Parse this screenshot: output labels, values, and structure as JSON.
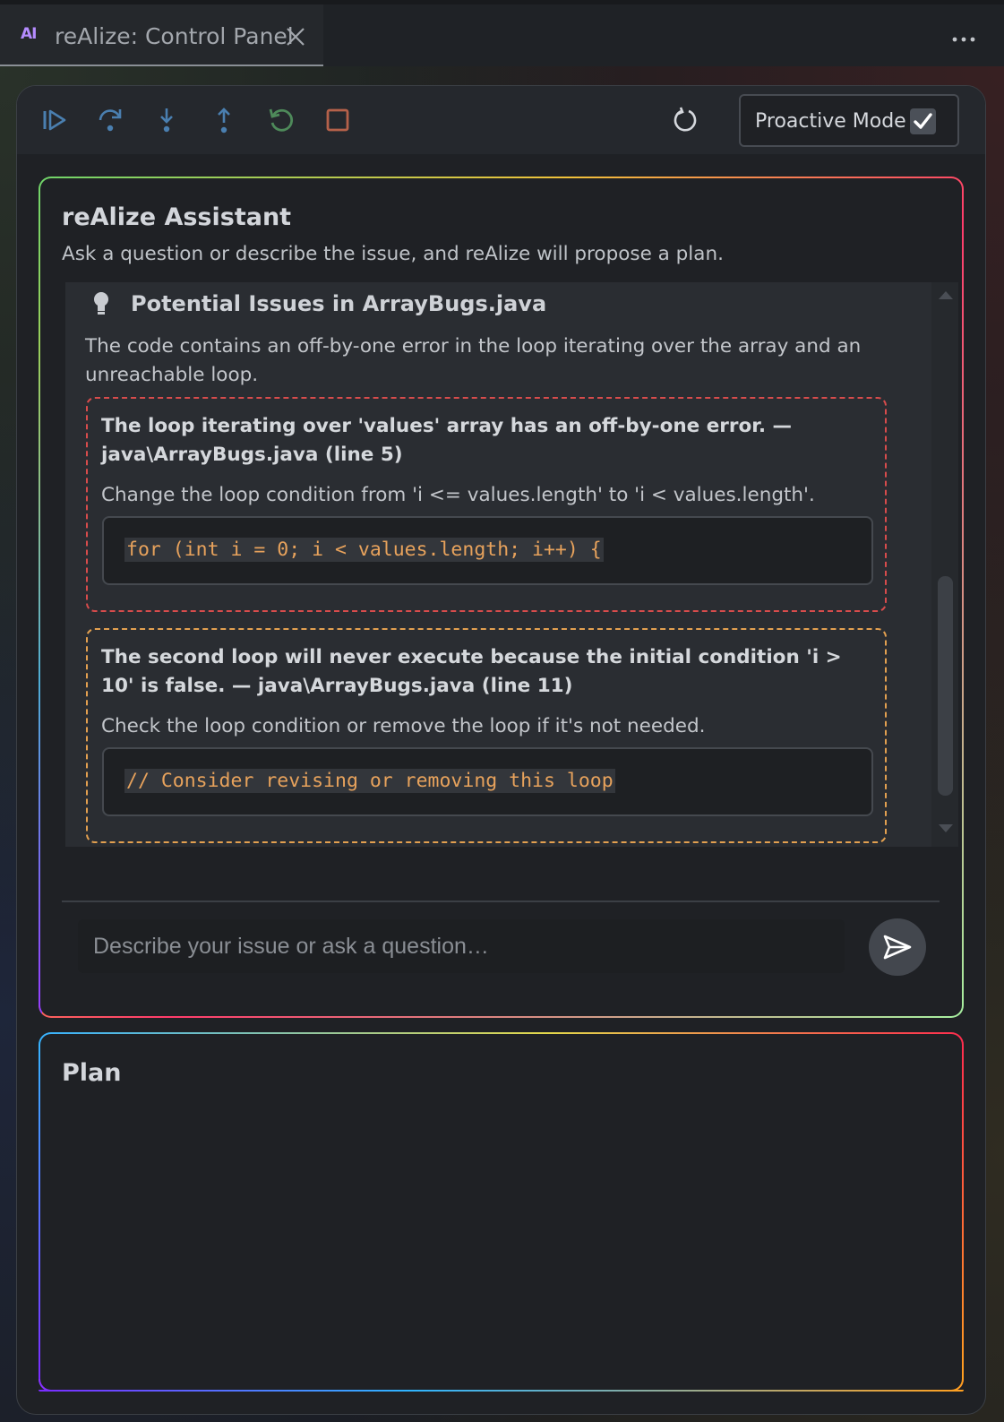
{
  "tab": {
    "badge": "AI",
    "title": "reAlize: Control Panel"
  },
  "toolbar": {
    "icons": [
      "continue-icon",
      "step-over-icon",
      "step-into-icon",
      "step-out-icon",
      "restart-icon",
      "stop-icon",
      "refresh-icon"
    ],
    "proactive_label": "Proactive Mode",
    "proactive_checked": true
  },
  "assistant": {
    "title": "reAlize Assistant",
    "subtitle": "Ask a question or describe the issue, and reAlize will propose a plan.",
    "message": {
      "title": "Potential Issues in ArrayBugs.java",
      "text": "The code contains an off-by-one error in the loop iterating over the array and an unreachable loop.",
      "issues": [
        {
          "title": "The loop iterating over 'values' array has an off-by-one error. — java\\ArrayBugs.java (line 5)",
          "desc": "Change the loop condition from 'i <= values.length' to 'i < values.length'.",
          "code": "for (int i = 0; i < values.length; i++) {",
          "color": "#d84c4c"
        },
        {
          "title": "The second loop will never execute because the initial condition 'i > 10' is false. — java\\ArrayBugs.java (line 11)",
          "desc": "Check the loop condition or remove the loop if it's not needed.",
          "code": "// Consider revising or removing this loop",
          "color": "#e3a050"
        }
      ]
    },
    "input_placeholder": "Describe your issue or ask a question…"
  },
  "plan": {
    "title": "Plan"
  },
  "colors": {
    "accent_blue": "#4a7fb0",
    "accent_green": "#4e8a5a",
    "accent_red": "#b5614a"
  }
}
